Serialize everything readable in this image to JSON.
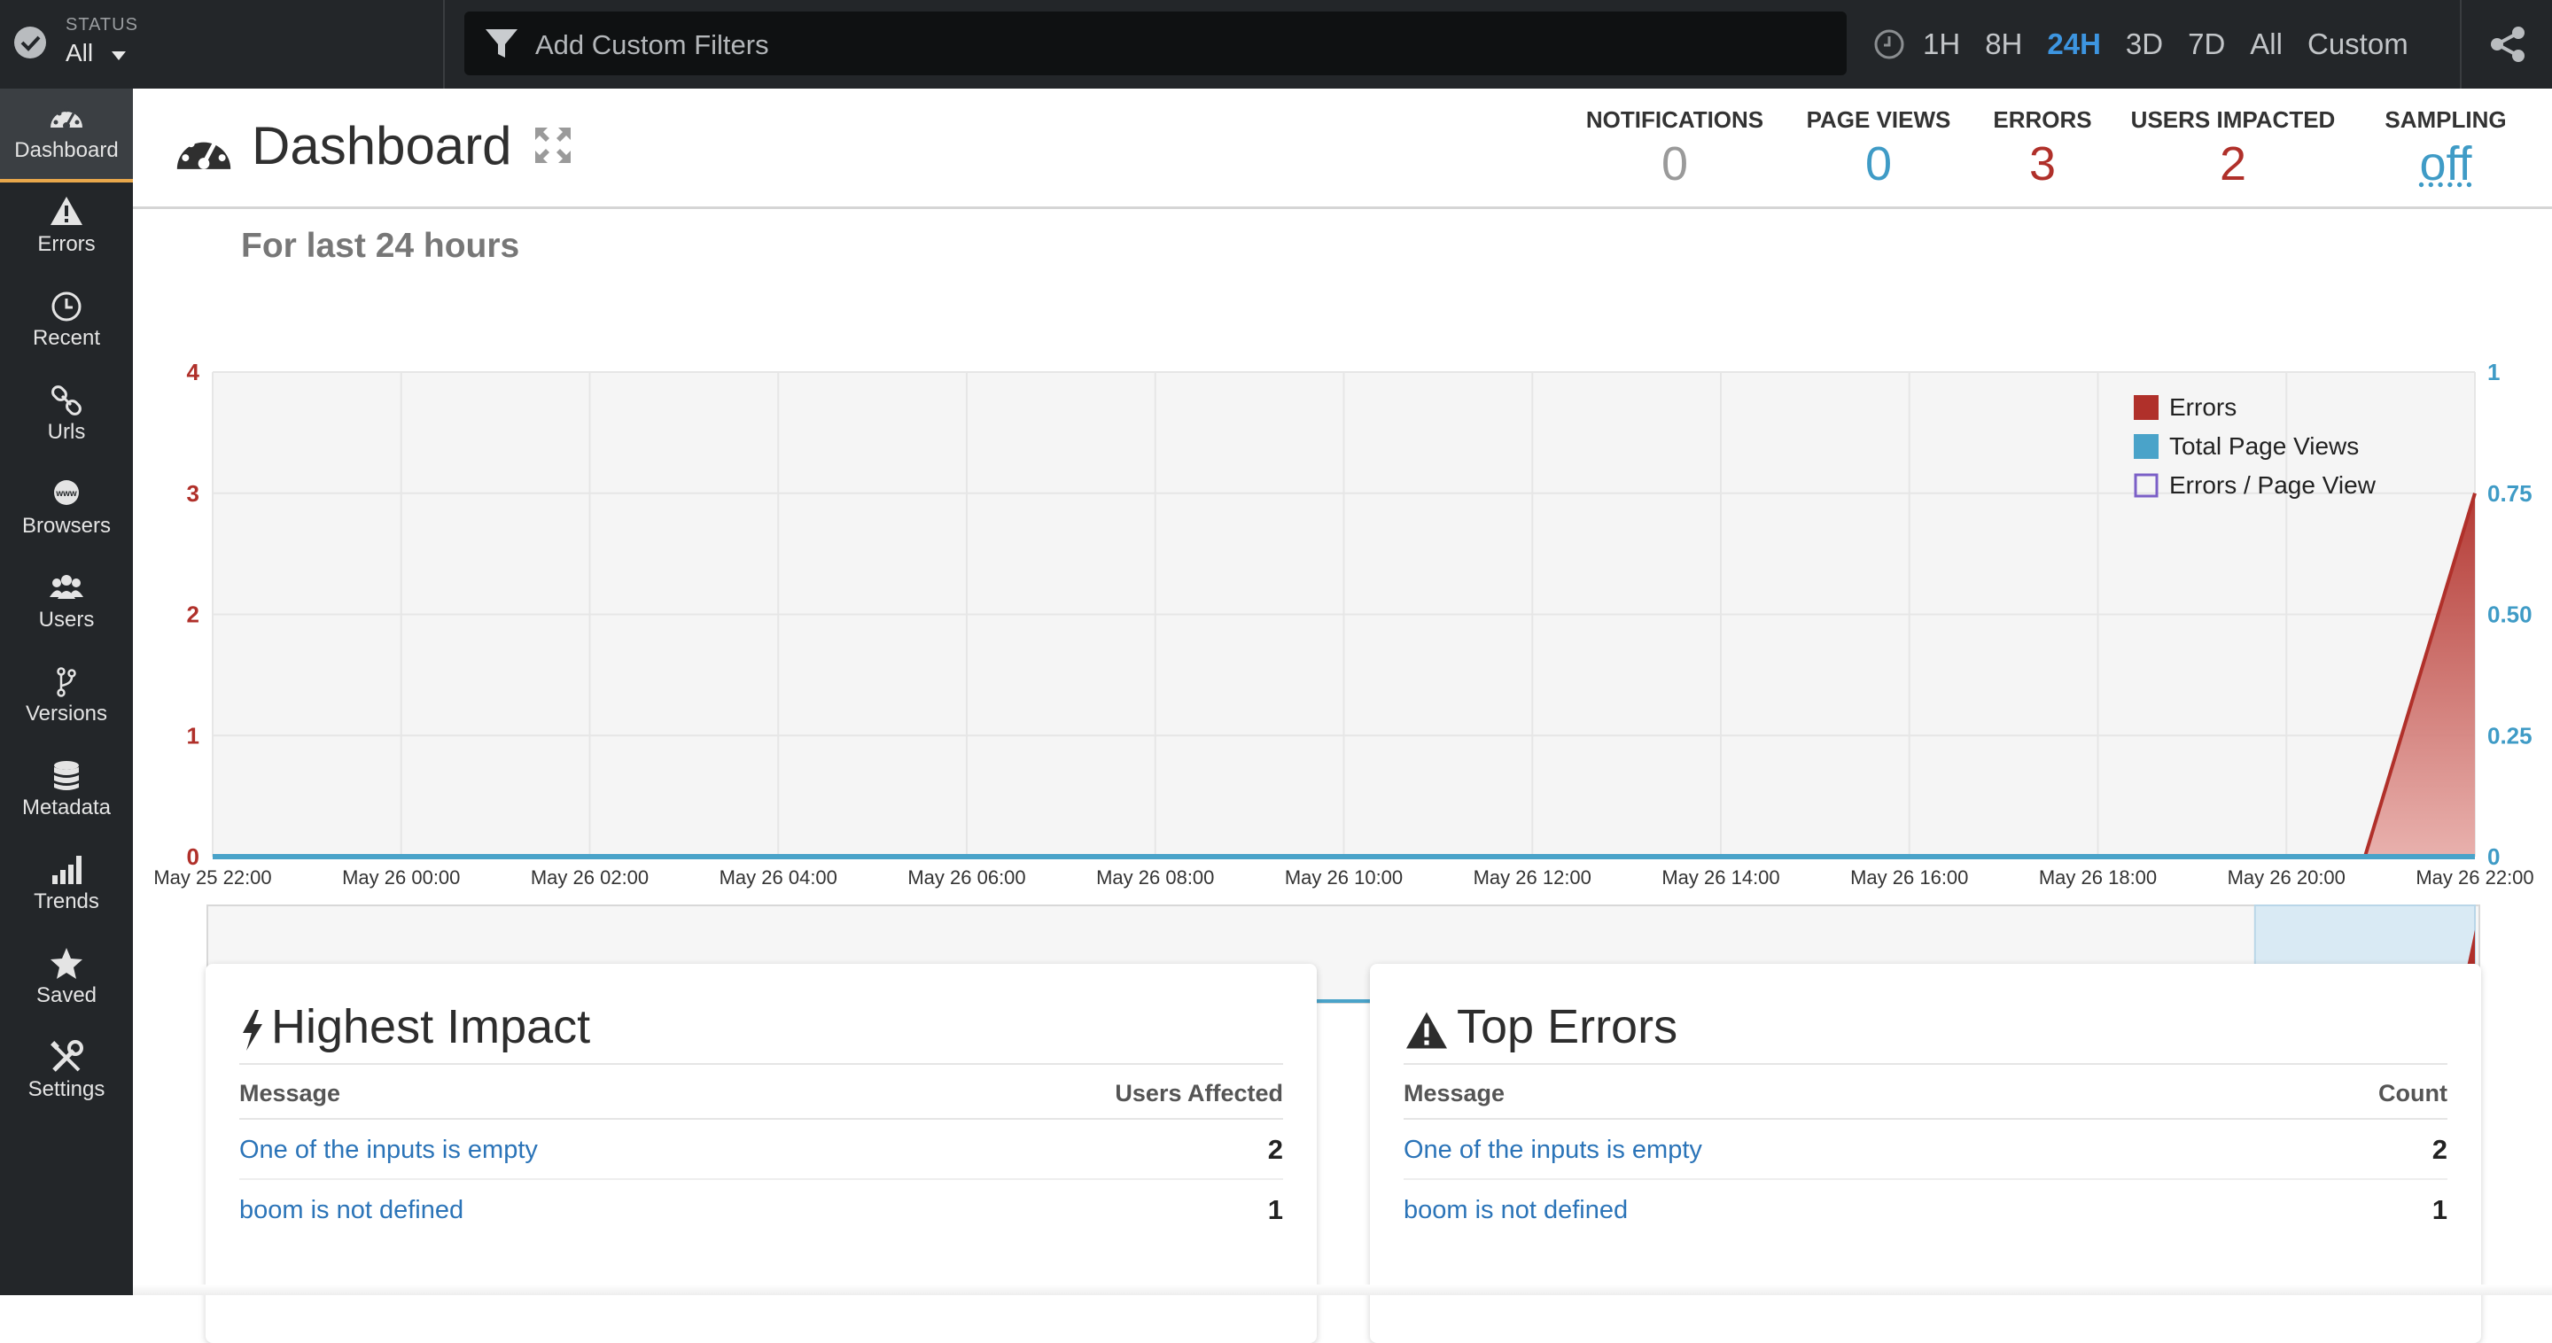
{
  "status": {
    "label": "STATUS",
    "value": "All"
  },
  "filter": {
    "placeholder": "Add Custom Filters"
  },
  "time_ranges": [
    {
      "label": "1H",
      "active": false
    },
    {
      "label": "8H",
      "active": false
    },
    {
      "label": "24H",
      "active": true
    },
    {
      "label": "3D",
      "active": false
    },
    {
      "label": "7D",
      "active": false
    },
    {
      "label": "All",
      "active": false
    },
    {
      "label": "Custom",
      "active": false
    }
  ],
  "sidebar": {
    "items": [
      {
        "label": "Dashboard",
        "icon": "dashboard-icon",
        "active": true
      },
      {
        "label": "Errors",
        "icon": "warning-icon"
      },
      {
        "label": "Recent",
        "icon": "clock-icon"
      },
      {
        "label": "Urls",
        "icon": "link-icon"
      },
      {
        "label": "Browsers",
        "icon": "globe-icon"
      },
      {
        "label": "Users",
        "icon": "users-icon"
      },
      {
        "label": "Versions",
        "icon": "branch-icon"
      },
      {
        "label": "Metadata",
        "icon": "database-icon"
      },
      {
        "label": "Trends",
        "icon": "bar-chart-icon"
      },
      {
        "label": "Saved",
        "icon": "star-icon"
      },
      {
        "label": "Settings",
        "icon": "tools-icon"
      }
    ]
  },
  "page": {
    "title": "Dashboard"
  },
  "stats": [
    {
      "label": "NOTIFICATIONS",
      "value": "0",
      "color": "#9a9a9a"
    },
    {
      "label": "PAGE VIEWS",
      "value": "0",
      "color": "#3f9bc6"
    },
    {
      "label": "ERRORS",
      "value": "3",
      "color": "#b0302a"
    },
    {
      "label": "USERS IMPACTED",
      "value": "2",
      "color": "#b0302a"
    },
    {
      "label": "SAMPLING",
      "value": "off",
      "color": "#3f9bc6"
    }
  ],
  "chart_data": {
    "type": "area",
    "title": "For last 24 hours",
    "x": [
      "May 25 22:00",
      "May 26 00:00",
      "May 26 02:00",
      "May 26 04:00",
      "May 26 06:00",
      "May 26 08:00",
      "May 26 10:00",
      "May 26 12:00",
      "May 26 14:00",
      "May 26 16:00",
      "May 26 18:00",
      "May 26 20:00",
      "May 26 22:00"
    ],
    "y_left": {
      "ticks": [
        "0",
        "1",
        "2",
        "3",
        "4"
      ],
      "ylim": [
        0,
        4
      ],
      "color": "#b0302a"
    },
    "y_right": {
      "ticks": [
        "0",
        "0.25",
        "0.50",
        "0.75",
        "1"
      ],
      "ylim": [
        0,
        1
      ],
      "color": "#3f9bc6"
    },
    "series": [
      {
        "name": "Errors",
        "color": "#b0302a",
        "points": [
          [
            "May 26 20:50",
            0
          ],
          [
            "May 26 22:00",
            3
          ]
        ]
      },
      {
        "name": "Total Page Views",
        "color": "#4aa3c9",
        "points": [
          [
            "May 25 22:00",
            0
          ],
          [
            "May 26 22:00",
            0
          ]
        ]
      },
      {
        "name": "Errors / Page View",
        "color": "#7b5fc7",
        "points": []
      }
    ],
    "legend": "top-right",
    "grid": true
  },
  "highest_impact": {
    "title": "Highest Impact",
    "col_message": "Message",
    "col_value": "Users Affected",
    "rows": [
      {
        "message": "One of the inputs is empty",
        "value": "2"
      },
      {
        "message": "boom is not defined",
        "value": "1"
      }
    ]
  },
  "top_errors": {
    "title": "Top Errors",
    "col_message": "Message",
    "col_value": "Count",
    "rows": [
      {
        "message": "One of the inputs is empty",
        "value": "2"
      },
      {
        "message": "boom is not defined",
        "value": "1"
      }
    ]
  }
}
